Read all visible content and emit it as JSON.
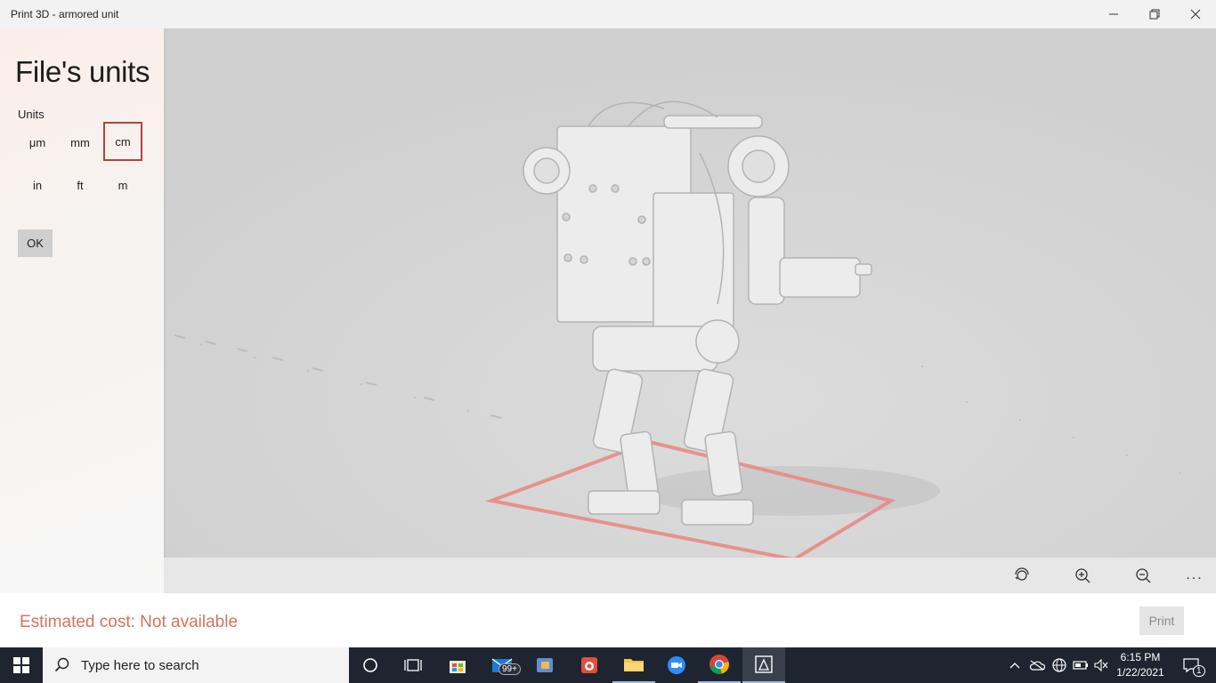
{
  "window": {
    "title": "Print 3D - armored unit"
  },
  "panel": {
    "title": "File's units",
    "units_label": "Units",
    "units": [
      "μm",
      "mm",
      "cm",
      "in",
      "ft",
      "m"
    ],
    "selected_unit": "cm",
    "ok_label": "OK"
  },
  "footer": {
    "cost_text": "Estimated cost: Not available",
    "print_label": "Print"
  },
  "view_toolbar": {
    "icons": [
      "reset-view-icon",
      "zoom-in-icon",
      "zoom-out-icon",
      "more-icon"
    ],
    "more_label": "..."
  },
  "taskbar": {
    "search_placeholder": "Type here to search",
    "mail_badge": "99+",
    "time": "6:15 PM",
    "date": "1/22/2021",
    "notification_count": "1"
  },
  "colors": {
    "accent_selected": "#b5433a",
    "cost_text": "#d4735e",
    "taskbar": "#1f2530"
  }
}
